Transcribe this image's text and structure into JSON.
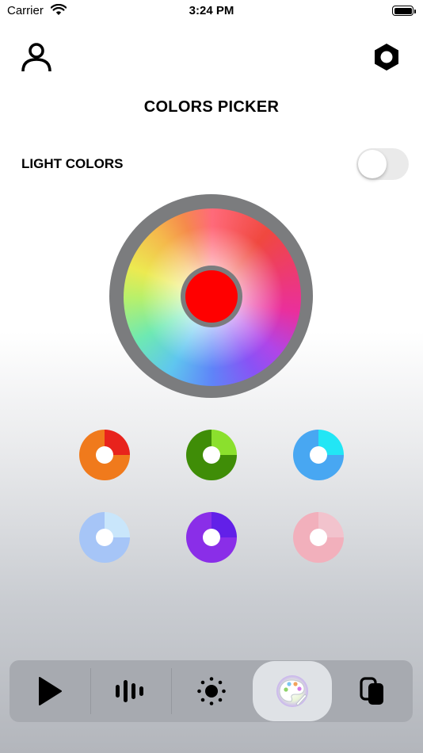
{
  "status_bar": {
    "carrier": "Carrier",
    "time": "3:24 PM"
  },
  "header": {
    "title": "COLORS PICKER",
    "left_icon": "user-icon",
    "right_icon": "settings-hexagon-icon"
  },
  "light_colors": {
    "label": "LIGHT COLORS",
    "enabled": false
  },
  "color_wheel": {
    "selected_color": "#ff0000",
    "ring_color": "#7b7c7e"
  },
  "presets": [
    {
      "name": "orange-red",
      "colors": [
        "#e8231c",
        "#f07a1c"
      ]
    },
    {
      "name": "green",
      "colors": [
        "#8be02d",
        "#3f8d07"
      ]
    },
    {
      "name": "sky-blue",
      "colors": [
        "#22e6f5",
        "#48a7f2"
      ]
    },
    {
      "name": "light-blue",
      "colors": [
        "#c9e6fb",
        "#a6c5f7"
      ]
    },
    {
      "name": "purple",
      "colors": [
        "#6220e8",
        "#8a2ee8"
      ]
    },
    {
      "name": "pink",
      "colors": [
        "#f2c3cd",
        "#f2b0bc"
      ]
    }
  ],
  "tab_bar": {
    "tabs": [
      "play",
      "music-bars",
      "brightness",
      "palette",
      "copy"
    ],
    "active": "palette"
  }
}
